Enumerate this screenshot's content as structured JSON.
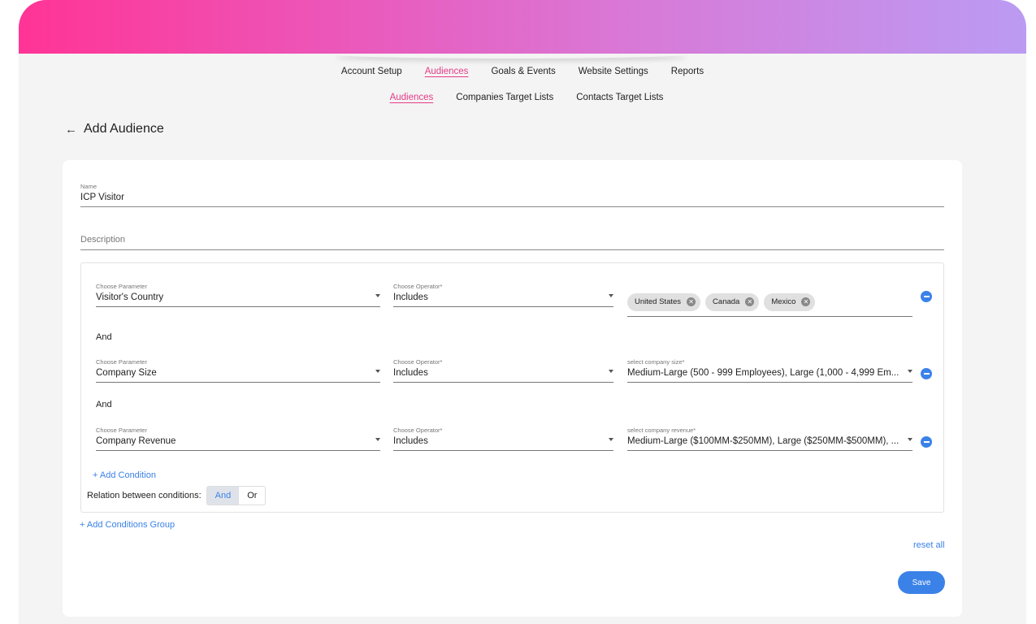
{
  "nav": {
    "items": [
      "Account Setup",
      "Audiences",
      "Goals & Events",
      "Website Settings",
      "Reports"
    ],
    "active": "Audiences"
  },
  "subnav": {
    "items": [
      "Audiences",
      "Companies Target Lists",
      "Contacts Target Lists"
    ],
    "active": "Audiences"
  },
  "page": {
    "title": "Add Audience",
    "back_icon": "arrow-left-icon"
  },
  "form": {
    "name_label": "Name",
    "name_value": "ICP Visitor",
    "description_placeholder": "Description"
  },
  "conditions": [
    {
      "param_label": "Choose Parameter",
      "param_value": "Visitor's Country",
      "op_label": "Choose Operator*",
      "op_value": "Includes",
      "chips": [
        "United States",
        "Canada",
        "Mexico"
      ]
    },
    {
      "param_label": "Choose Parameter",
      "param_value": "Company Size",
      "op_label": "Choose Operator*",
      "op_value": "Includes",
      "value_label": "select company size*",
      "value": "Medium-Large (500 - 999 Employees), Large (1,000 - 4,999 Em..."
    },
    {
      "param_label": "Choose Parameter",
      "param_value": "Company Revenue",
      "op_label": "Choose Operator*",
      "op_value": "Includes",
      "value_label": "select company revenue*",
      "value": "Medium-Large ($100MM-$250MM), Large ($250MM-$500MM), ..."
    }
  ],
  "and_label": "And",
  "add_condition": "+ Add Condition",
  "relation": {
    "label": "Relation between conditions:",
    "and": "And",
    "or": "Or",
    "selected": "And"
  },
  "add_group": "+ Add Conditions Group",
  "reset_all": "reset all",
  "save": "Save",
  "colors": {
    "accent": "#3b82e8",
    "active_nav": "#e63b88",
    "gradient_start": "#ff3496",
    "gradient_end": "#bb9bf3"
  }
}
